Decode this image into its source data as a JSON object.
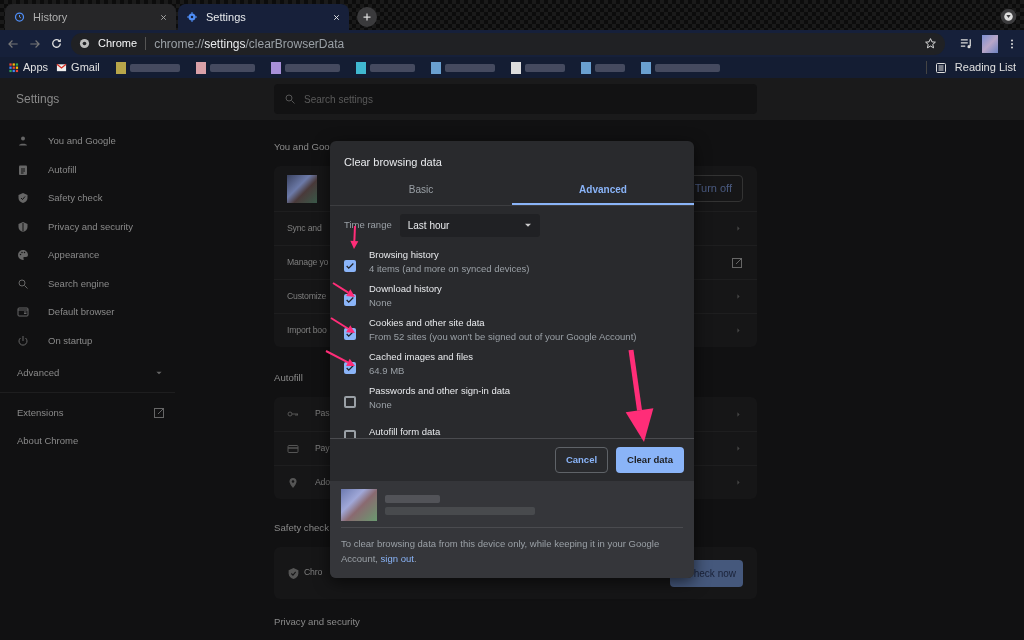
{
  "browser_tabs": [
    {
      "title": "History",
      "selected": false
    },
    {
      "title": "Settings",
      "selected": true
    }
  ],
  "omnibox": {
    "site_label": "Chrome",
    "url": "chrome://**settings**/clearBrowserData"
  },
  "bookmarks": [
    {
      "label": "Apps"
    },
    {
      "label": "Gmail"
    }
  ],
  "reading_list": "Reading List",
  "settings_title": "Settings",
  "search": {
    "placeholder": "Search settings"
  },
  "sidebar": {
    "items": [
      {
        "label": "You and Google"
      },
      {
        "label": "Autofill"
      },
      {
        "label": "Safety check"
      },
      {
        "label": "Privacy and security"
      },
      {
        "label": "Appearance"
      },
      {
        "label": "Search engine"
      },
      {
        "label": "Default browser"
      },
      {
        "label": "On startup"
      }
    ],
    "advanced": {
      "label": "Advanced",
      "expanded": false
    },
    "links": [
      {
        "label": "Extensions",
        "kind": "external"
      },
      {
        "label": "About Chrome",
        "kind": "plain"
      }
    ]
  },
  "sections": [
    {
      "heading": "You and Goo",
      "rows": [
        {
          "kind": "account",
          "button": "Turn off"
        },
        {
          "kind": "chevron",
          "label": "Sync and"
        },
        {
          "kind": "external",
          "label": "Manage yo"
        },
        {
          "kind": "chevron",
          "label": "Customize"
        },
        {
          "kind": "chevron",
          "label": "Import boo"
        }
      ]
    },
    {
      "heading": "Autofill",
      "rows": [
        {
          "kind": "key",
          "label": "Pas"
        },
        {
          "kind": "card",
          "label": "Pay"
        },
        {
          "kind": "pin",
          "label": "Ado"
        }
      ]
    },
    {
      "heading": "Safety check",
      "rows": [
        {
          "kind": "action",
          "label": "Chro",
          "button": "heck now"
        }
      ]
    },
    {
      "heading": "Privacy and security"
    }
  ],
  "dialog": {
    "title": "Clear browsing data",
    "tabs": [
      {
        "label": "Basic",
        "selected": false
      },
      {
        "label": "Advanced",
        "selected": true
      }
    ],
    "time_range": {
      "label": "Time range",
      "value": "Last hour"
    },
    "options": [
      {
        "title": "Browsing history",
        "detail": "4 items (and more on synced devices)",
        "checked": true
      },
      {
        "title": "Download history",
        "detail": "None",
        "checked": true
      },
      {
        "title": "Cookies and other site data",
        "detail": "From 52 sites (you won't be signed out of your Google Account)",
        "checked": true
      },
      {
        "title": "Cached images and files",
        "detail": "64.9 MB",
        "checked": true
      },
      {
        "title": "Passwords and other sign-in data",
        "detail": "None",
        "checked": false
      },
      {
        "title": "Autofill form data",
        "checked": false
      }
    ],
    "cancel": "Cancel",
    "confirm": "Clear data",
    "note": {
      "before": "To clear browsing data from this device only, while keeping it in your Google Account, ",
      "link": "sign out",
      "after": "."
    }
  }
}
